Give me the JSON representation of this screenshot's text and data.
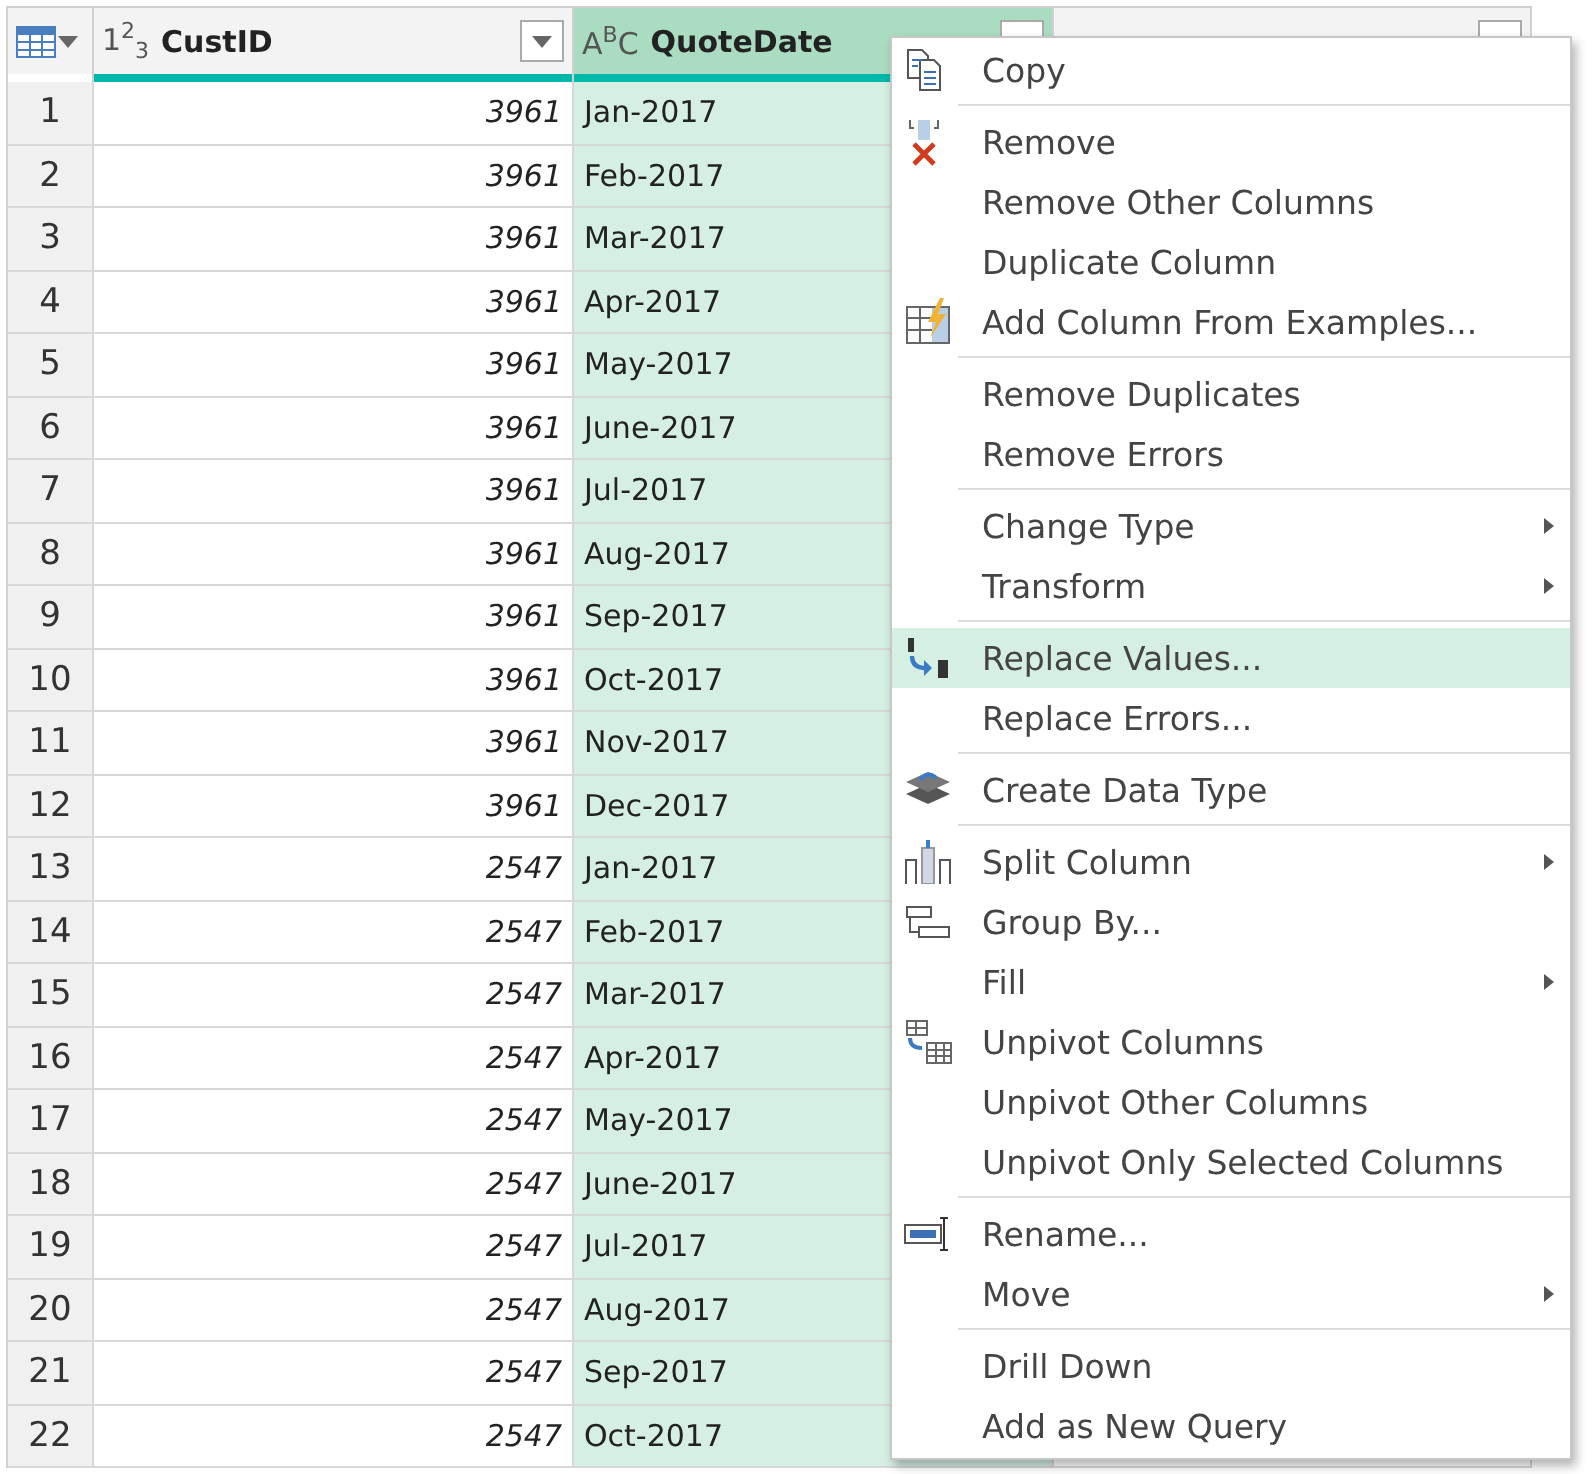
{
  "columns": [
    {
      "type_label": "1$^{2}$$_{3}$",
      "label": "CustID",
      "selected": false
    },
    {
      "type_label": "A$^{B}$C",
      "label": "QuoteDate",
      "selected": true
    }
  ],
  "rows": [
    {
      "n": "1",
      "cust_id": "3961",
      "quote_date": "Jan-2017"
    },
    {
      "n": "2",
      "cust_id": "3961",
      "quote_date": "Feb-2017"
    },
    {
      "n": "3",
      "cust_id": "3961",
      "quote_date": "Mar-2017"
    },
    {
      "n": "4",
      "cust_id": "3961",
      "quote_date": "Apr-2017"
    },
    {
      "n": "5",
      "cust_id": "3961",
      "quote_date": "May-2017"
    },
    {
      "n": "6",
      "cust_id": "3961",
      "quote_date": "June-2017"
    },
    {
      "n": "7",
      "cust_id": "3961",
      "quote_date": "Jul-2017"
    },
    {
      "n": "8",
      "cust_id": "3961",
      "quote_date": "Aug-2017"
    },
    {
      "n": "9",
      "cust_id": "3961",
      "quote_date": "Sep-2017"
    },
    {
      "n": "10",
      "cust_id": "3961",
      "quote_date": "Oct-2017"
    },
    {
      "n": "11",
      "cust_id": "3961",
      "quote_date": "Nov-2017"
    },
    {
      "n": "12",
      "cust_id": "3961",
      "quote_date": "Dec-2017"
    },
    {
      "n": "13",
      "cust_id": "2547",
      "quote_date": "Jan-2017"
    },
    {
      "n": "14",
      "cust_id": "2547",
      "quote_date": "Feb-2017"
    },
    {
      "n": "15",
      "cust_id": "2547",
      "quote_date": "Mar-2017"
    },
    {
      "n": "16",
      "cust_id": "2547",
      "quote_date": "Apr-2017"
    },
    {
      "n": "17",
      "cust_id": "2547",
      "quote_date": "May-2017"
    },
    {
      "n": "18",
      "cust_id": "2547",
      "quote_date": "June-2017"
    },
    {
      "n": "19",
      "cust_id": "2547",
      "quote_date": "Jul-2017"
    },
    {
      "n": "20",
      "cust_id": "2547",
      "quote_date": "Aug-2017"
    },
    {
      "n": "21",
      "cust_id": "2547",
      "quote_date": "Sep-2017"
    },
    {
      "n": "22",
      "cust_id": "2547",
      "quote_date": "Oct-2017"
    }
  ],
  "context_menu": {
    "items": [
      {
        "kind": "item",
        "label": "Copy",
        "submenu": false,
        "selected": false
      },
      {
        "kind": "separator"
      },
      {
        "kind": "item",
        "label": "Remove",
        "submenu": false,
        "selected": false
      },
      {
        "kind": "item",
        "label": "Remove Other Columns",
        "submenu": false,
        "selected": false
      },
      {
        "kind": "item",
        "label": "Duplicate Column",
        "submenu": false,
        "selected": false
      },
      {
        "kind": "item",
        "label": "Add Column From Examples...",
        "submenu": false,
        "selected": false
      },
      {
        "kind": "separator"
      },
      {
        "kind": "item",
        "label": "Remove Duplicates",
        "submenu": false,
        "selected": false
      },
      {
        "kind": "item",
        "label": "Remove Errors",
        "submenu": false,
        "selected": false
      },
      {
        "kind": "separator"
      },
      {
        "kind": "item",
        "label": "Change Type",
        "submenu": true,
        "selected": false
      },
      {
        "kind": "item",
        "label": "Transform",
        "submenu": true,
        "selected": false
      },
      {
        "kind": "separator"
      },
      {
        "kind": "item",
        "label": "Replace Values...",
        "submenu": false,
        "selected": true
      },
      {
        "kind": "item",
        "label": "Replace Errors...",
        "submenu": false,
        "selected": false
      },
      {
        "kind": "separator"
      },
      {
        "kind": "item",
        "label": "Create Data Type",
        "submenu": false,
        "selected": false
      },
      {
        "kind": "separator"
      },
      {
        "kind": "item",
        "label": "Split Column",
        "submenu": true,
        "selected": false
      },
      {
        "kind": "item",
        "label": "Group By...",
        "submenu": false,
        "selected": false
      },
      {
        "kind": "item",
        "label": "Fill",
        "submenu": true,
        "selected": false
      },
      {
        "kind": "item",
        "label": "Unpivot Columns",
        "submenu": false,
        "selected": false
      },
      {
        "kind": "item",
        "label": "Unpivot Other Columns",
        "submenu": false,
        "selected": false
      },
      {
        "kind": "item",
        "label": "Unpivot Only Selected Columns",
        "submenu": false,
        "selected": false
      },
      {
        "kind": "separator"
      },
      {
        "kind": "item",
        "label": "Rename...",
        "submenu": false,
        "selected": false
      },
      {
        "kind": "item",
        "label": "Move",
        "submenu": true,
        "selected": false
      },
      {
        "kind": "separator"
      },
      {
        "kind": "item",
        "label": "Drill Down",
        "submenu": false,
        "selected": false
      },
      {
        "kind": "item",
        "label": "Add as New Query",
        "submenu": false,
        "selected": false
      }
    ]
  }
}
